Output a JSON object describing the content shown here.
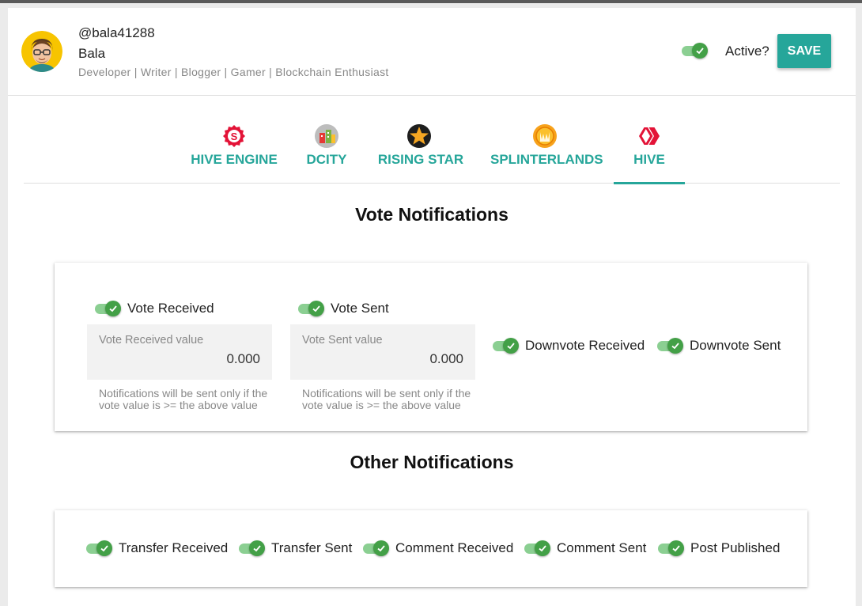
{
  "profile": {
    "handle": "@bala41288",
    "name": "Bala",
    "bio": "Developer | Writer | Blogger | Gamer | Blockchain Enthusiast"
  },
  "header": {
    "active_label": "Active?",
    "active_on": true,
    "save_label": "SAVE"
  },
  "tabs": [
    {
      "label": "HIVE ENGINE",
      "icon": "hive-engine-icon",
      "active": false
    },
    {
      "label": "DCITY",
      "icon": "dcity-icon",
      "active": false
    },
    {
      "label": "RISING STAR",
      "icon": "rising-star-icon",
      "active": false
    },
    {
      "label": "SPLINTERLANDS",
      "icon": "splinterlands-icon",
      "active": false
    },
    {
      "label": "HIVE",
      "icon": "hive-icon",
      "active": true
    }
  ],
  "vote": {
    "title": "Vote Notifications",
    "received": {
      "label": "Vote Received",
      "field_label": "Vote Received value",
      "value": "0.000",
      "helper": "Notifications will be sent only if the vote value is >= the above value"
    },
    "sent": {
      "label": "Vote Sent",
      "field_label": "Vote Sent value",
      "value": "0.000",
      "helper": "Notifications will be sent only if the vote value is >= the above value"
    },
    "downvote_received": "Downvote Received",
    "downvote_sent": "Downvote Sent"
  },
  "other": {
    "title": "Other Notifications",
    "items": [
      "Transfer Received",
      "Transfer Sent",
      "Comment Received",
      "Comment Sent",
      "Post Published"
    ]
  },
  "colors": {
    "accent": "#26a69a",
    "toggle_on": "#43a047",
    "toggle_track": "#8bcf92"
  }
}
